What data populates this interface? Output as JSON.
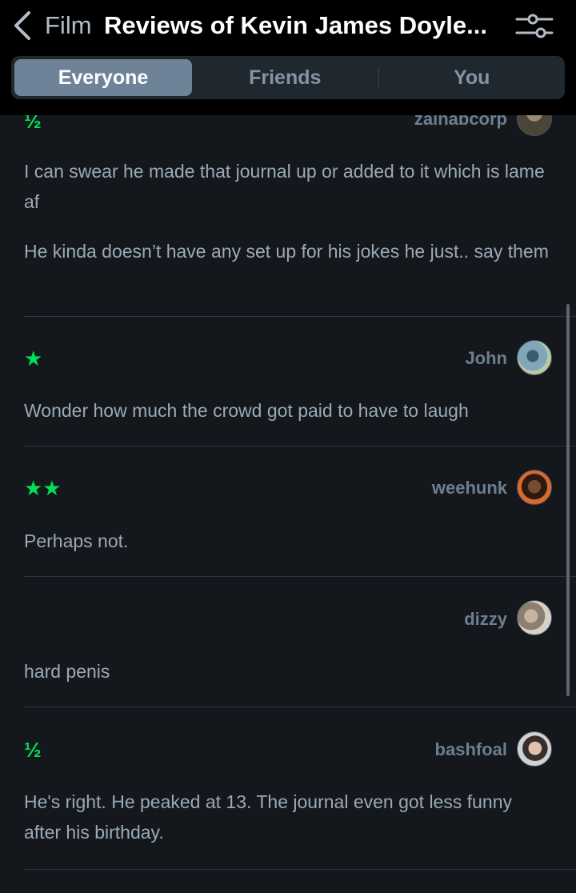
{
  "header": {
    "crumb": "Film",
    "title": "Reviews of Kevin James Doyle...",
    "tabs": [
      {
        "label": "Everyone",
        "active": true
      },
      {
        "label": "Friends",
        "active": false
      },
      {
        "label": "You",
        "active": false
      }
    ]
  },
  "reviews": [
    {
      "rating": "½",
      "user": "zainabcorp",
      "paragraphs": [
        "I can swear he made that journal up or added to it which is lame af",
        "He kinda doesn’t have any set up for his jokes he just.. say them"
      ]
    },
    {
      "rating": "★",
      "user": "John",
      "paragraphs": [
        "Wonder how much the crowd got paid to have to laugh"
      ]
    },
    {
      "rating": "★★",
      "user": "weehunk",
      "paragraphs": [
        "Perhaps not."
      ]
    },
    {
      "rating": "",
      "user": "dizzy",
      "paragraphs": [
        "hard penis"
      ]
    },
    {
      "rating": "½",
      "user": "bashfoal",
      "paragraphs": [
        "He's right. He peaked at 13. The journal even got less funny after his birthday."
      ]
    }
  ],
  "colors": {
    "rating_green": "#00e054",
    "active_tab": "#6e8398",
    "background": "#14181c"
  },
  "icons": {
    "back": "chevron-left-icon",
    "filter": "sliders-icon"
  }
}
